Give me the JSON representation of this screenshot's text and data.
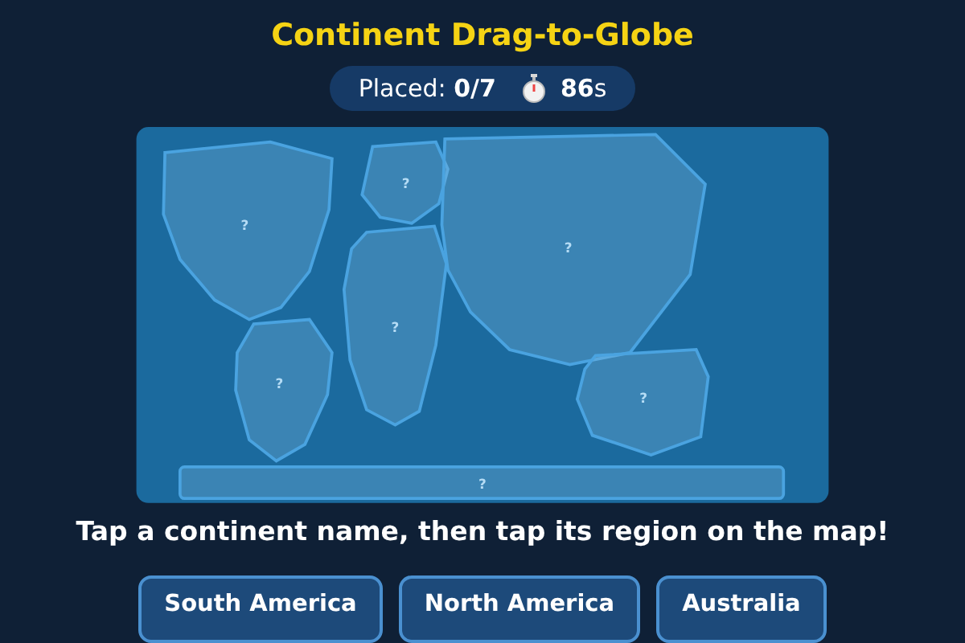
{
  "title": "Continent Drag-to-Globe",
  "status": {
    "placed": "Placed: **0/7**",
    "timer": "**86**s"
  },
  "regions": [
    {
      "label": "?"
    },
    {
      "label": "?"
    },
    {
      "label": "?"
    },
    {
      "label": "?"
    },
    {
      "label": "?"
    },
    {
      "label": "?"
    },
    {
      "label": "?"
    }
  ],
  "instruction": "Tap a continent name, then tap its region on the map!",
  "choices": [
    {
      "label": "South America"
    },
    {
      "label": "North America"
    },
    {
      "label": "Australia"
    }
  ]
}
